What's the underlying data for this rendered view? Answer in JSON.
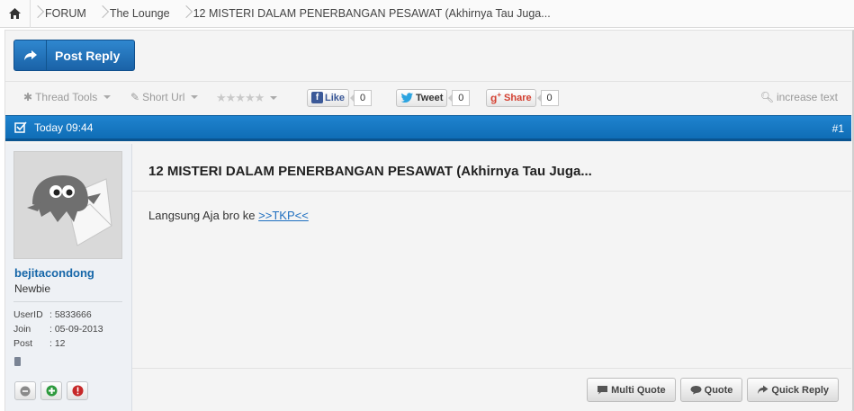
{
  "breadcrumb": {
    "home_icon": "home-icon",
    "items": [
      "FORUM",
      "The Lounge",
      "12 MISTERI DALAM PENERBANGAN PESAWAT (Akhirnya Tau Juga..."
    ]
  },
  "toolbar": {
    "post_reply_label": "Post Reply",
    "thread_tools_label": "Thread Tools",
    "short_url_label": "Short Url",
    "rating_stars": "★★★★★",
    "increase_text_label": "increase text"
  },
  "social": {
    "like_label": "Like",
    "like_count": "0",
    "tweet_label": "Tweet",
    "tweet_count": "0",
    "share_label": "Share",
    "share_count": "0"
  },
  "post": {
    "time": "Today 09:44",
    "number": "#1",
    "title": "12 MISTERI DALAM PENERBANGAN PESAWAT (Akhirnya Tau Juga...",
    "body_text": "Langsung Aja bro ke ",
    "body_link": ">>TKP<<"
  },
  "user": {
    "username": "bejitacondong",
    "title": "Newbie",
    "info": [
      {
        "key": "UserID",
        "value": ": 5833666"
      },
      {
        "key": "Join",
        "value": ": 05-09-2013"
      },
      {
        "key": "Post",
        "value": ": 12"
      }
    ]
  },
  "actions": {
    "multi_quote": "Multi Quote",
    "quote": "Quote",
    "quick_reply": "Quick Reply"
  },
  "colors": {
    "accent": "#1a73bd",
    "header_blue": "#1f83cf",
    "username": "#1566a8",
    "link": "#1f6fc0"
  }
}
